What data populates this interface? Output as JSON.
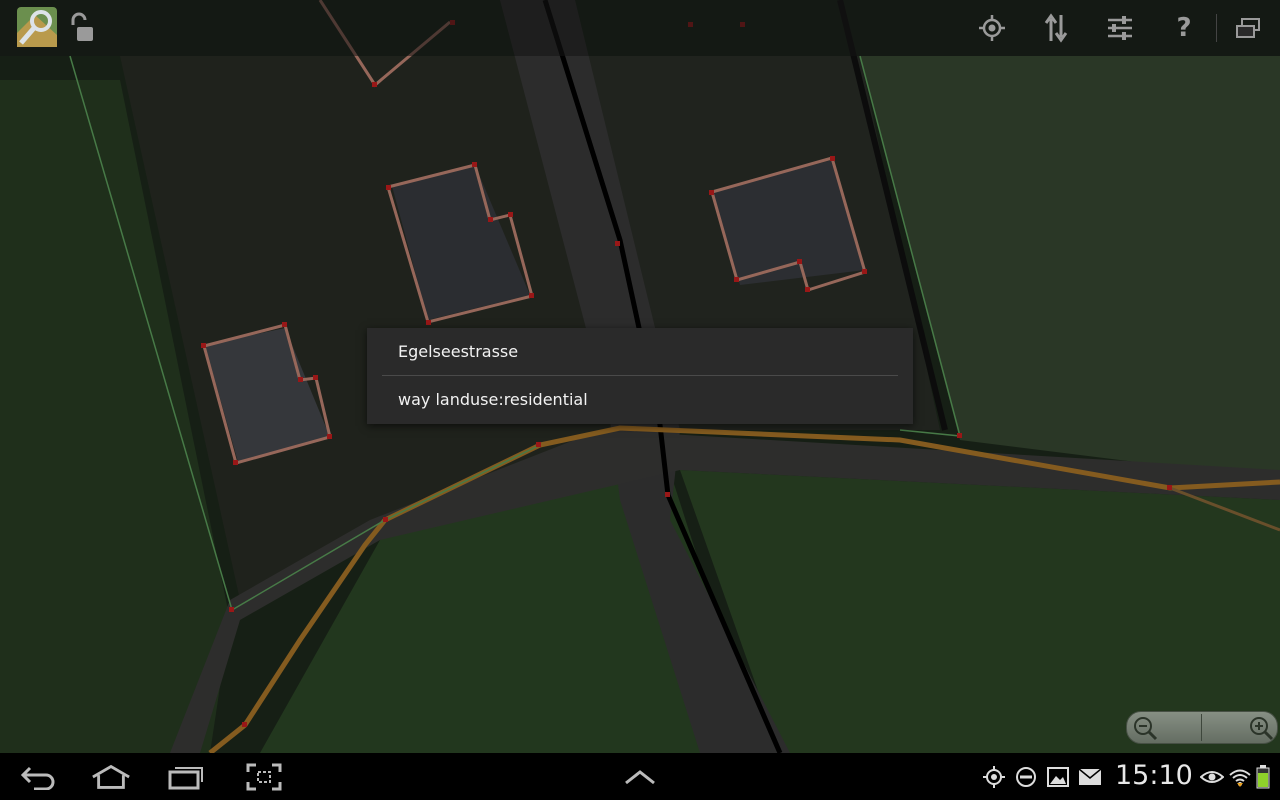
{
  "app": {
    "logo_icon": "map-magnifier-icon",
    "lock_icon": "unlocked-padlock-icon"
  },
  "actionbar": {
    "icons": [
      "gps-locate-icon",
      "transfer-icon",
      "tune-sliders-icon",
      "help-icon",
      "windows-icon"
    ]
  },
  "popup": {
    "items": [
      {
        "label": "Egelseestrasse"
      },
      {
        "label": "way landuse:residential"
      }
    ]
  },
  "zoom": {
    "out_icon": "zoom-out-icon",
    "in_icon": "zoom-in-icon"
  },
  "navbar": {
    "buttons": [
      "back-icon",
      "home-icon",
      "recent-apps-icon",
      "screenshot-icon",
      "up-chevron-icon"
    ],
    "status_icons": [
      "gps-icon",
      "do-not-disturb-icon",
      "gallery-icon",
      "mail-icon",
      "eye-icon",
      "wifi-icon",
      "battery-icon"
    ],
    "time": "15:10"
  },
  "colors": {
    "overlay": "#000000",
    "building_outline": "#c98a78",
    "road": "#c8882e",
    "landuse_line": "#5fa35f",
    "node": "#cc1f1f"
  }
}
